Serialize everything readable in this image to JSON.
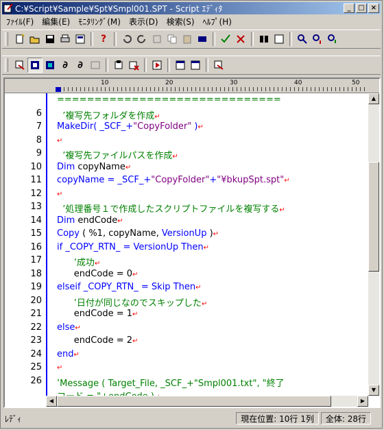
{
  "window": {
    "title": "C:¥Script¥Sample¥Spt¥Smpl001.SPT - Script ｴﾃﾞｨﾀ",
    "min_label": "_",
    "max_label": "□",
    "close_label": "×"
  },
  "menu": [
    "ﾌｧｲﾙ(F)",
    "編集(E)",
    "ﾓﾆﾀﾘﾝｸﾞ(M)",
    "表示(D)",
    "検索(S)",
    "ﾍﾙﾌﾟ(H)"
  ],
  "ruler": {
    "marks": [
      "10",
      "20",
      "30",
      "40",
      "50"
    ]
  },
  "editor": {
    "lines": [
      {
        "n": "",
        "segs": [
          {
            "t": "==============================",
            "c": "cm"
          }
        ]
      },
      {
        "n": "6",
        "segs": [
          {
            "t": "  ’複写先フォルダを作成",
            "c": "cm"
          }
        ],
        "nl": true
      },
      {
        "n": "7",
        "segs": [
          {
            "t": "MakeDir( _SCF_+",
            "c": "kw"
          },
          {
            "t": "\"CopyFolder\"",
            "c": "st"
          },
          {
            "t": " )",
            "c": "kw"
          }
        ],
        "nl": true
      },
      {
        "n": "8",
        "segs": [],
        "nl": true
      },
      {
        "n": "9",
        "segs": [
          {
            "t": "  ’複写先ファイルパスを作成",
            "c": "cm"
          }
        ],
        "nl": true
      },
      {
        "n": "10",
        "segs": [
          {
            "t": "Dim",
            "c": "kw"
          },
          {
            "t": " copyName",
            "c": "pl"
          }
        ],
        "nl": true
      },
      {
        "n": "11",
        "segs": [
          {
            "t": "copyName = _SCF_+",
            "c": "kw"
          },
          {
            "t": "\"CopyFolder\"",
            "c": "st"
          },
          {
            "t": "+",
            "c": "kw"
          },
          {
            "t": "\"¥bkupSpt.spt\"",
            "c": "st"
          }
        ],
        "nl": true
      },
      {
        "n": "12",
        "segs": [],
        "nl": true
      },
      {
        "n": "13",
        "segs": [
          {
            "t": "  ’処理番号１で作成したスクリプトファイルを複写する",
            "c": "cm"
          }
        ],
        "nl": true
      },
      {
        "n": "14",
        "segs": [
          {
            "t": "Dim",
            "c": "kw"
          },
          {
            "t": " endCode",
            "c": "pl"
          }
        ],
        "nl": true
      },
      {
        "n": "15",
        "segs": [
          {
            "t": "Copy",
            "c": "kw"
          },
          {
            "t": " ( %1, copyName, ",
            "c": "pl"
          },
          {
            "t": "VersionUp",
            "c": "kw"
          },
          {
            "t": " )",
            "c": "pl"
          }
        ],
        "nl": true
      },
      {
        "n": "16",
        "segs": [
          {
            "t": "if _COPY_RTN_ = VersionUp Then",
            "c": "kw"
          }
        ],
        "nl": true
      },
      {
        "n": "17",
        "segs": [
          {
            "t": "      ’成功",
            "c": "cm"
          }
        ],
        "nl": true
      },
      {
        "n": "18",
        "segs": [
          {
            "t": "      endCode = 0",
            "c": "pl"
          }
        ],
        "nl": true
      },
      {
        "n": "19",
        "segs": [
          {
            "t": "elseif _COPY_RTN_ = Skip Then",
            "c": "kw"
          }
        ],
        "nl": true
      },
      {
        "n": "20",
        "segs": [
          {
            "t": "      ’日付が同じなのでスキップした",
            "c": "cm"
          }
        ],
        "nl": true
      },
      {
        "n": "21",
        "segs": [
          {
            "t": "      endCode = 1",
            "c": "pl"
          }
        ],
        "nl": true
      },
      {
        "n": "22",
        "segs": [
          {
            "t": "else",
            "c": "kw"
          }
        ],
        "nl": true
      },
      {
        "n": "23",
        "segs": [
          {
            "t": "      endCode = 2",
            "c": "pl"
          }
        ],
        "nl": true
      },
      {
        "n": "24",
        "segs": [
          {
            "t": "end",
            "c": "kw"
          }
        ],
        "nl": true
      },
      {
        "n": "25",
        "segs": [],
        "nl": true
      },
      {
        "n": "26",
        "segs": [
          {
            "t": "’Message ( Target_File, _SCF_+\"Smpl001.txt\", \"終了",
            "c": "cm"
          }
        ]
      },
      {
        "n": "",
        "segs": [
          {
            "t": "コード = \"+endCode )",
            "c": "cm"
          }
        ],
        "nl": true
      }
    ]
  },
  "status": {
    "ready": "ﾚﾃﾞｨ",
    "position": "現在位置:   10行 1列",
    "total": "全体:   28行"
  },
  "colors": {
    "keyword": "#0000ff",
    "comment": "#008000",
    "string": "#800080",
    "newline_mark": "#ff0000"
  }
}
